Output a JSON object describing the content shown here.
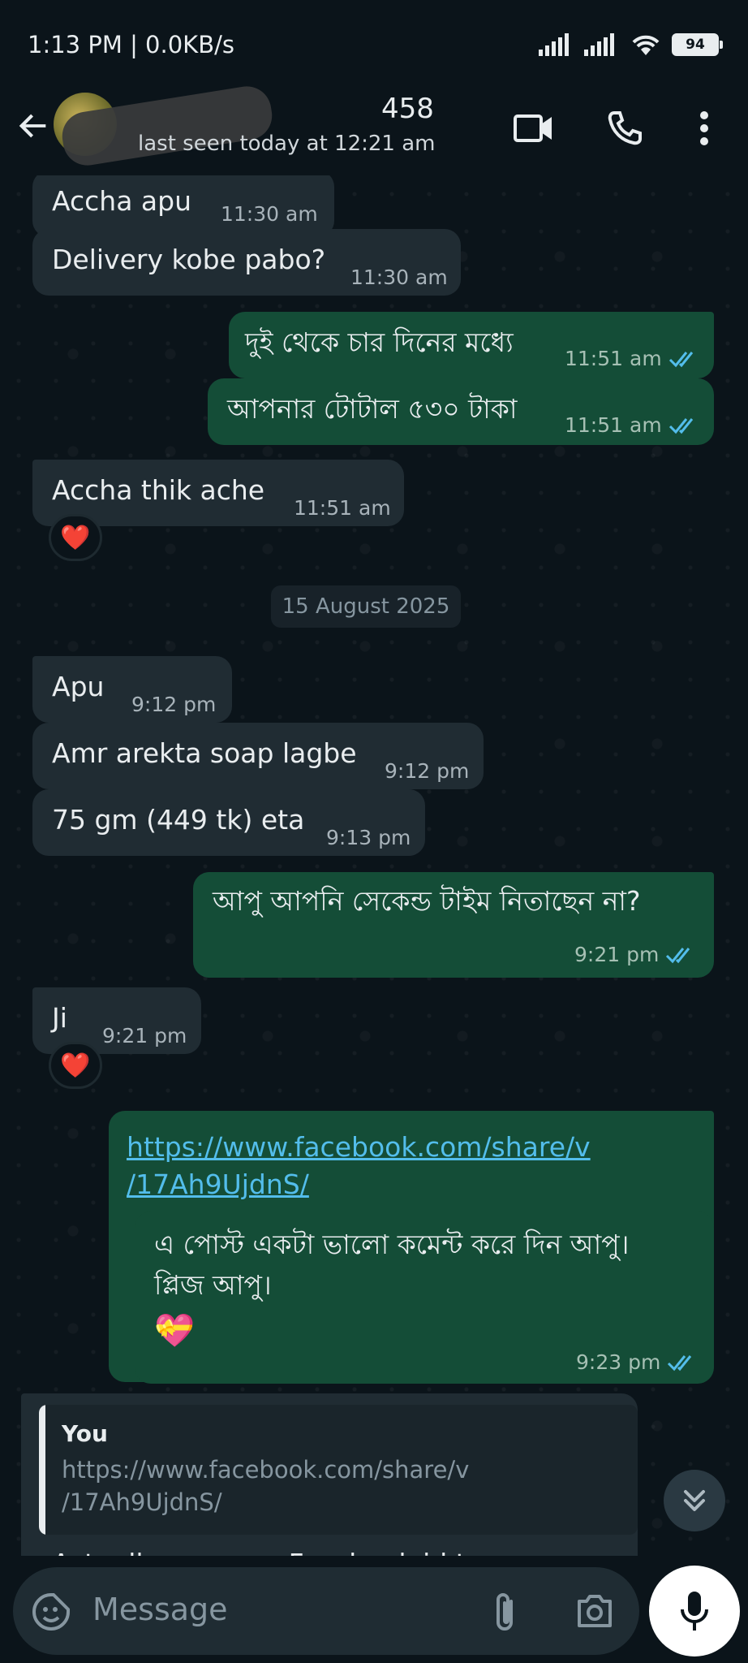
{
  "status_bar": {
    "time": "1:13 PM | 0.0KB/s",
    "battery": "94"
  },
  "header": {
    "contact_name_visible": "458",
    "last_seen": "last seen today at 12:21 am"
  },
  "messages": [
    {
      "dir": "in",
      "text": "Accha apu",
      "time": "11:30 am"
    },
    {
      "dir": "in",
      "text": "Delivery kobe pabo?",
      "time": "11:30 am"
    },
    {
      "dir": "out",
      "text": "দুই থেকে চার দিনের মধ্যে",
      "time": "11:51 am"
    },
    {
      "dir": "out",
      "text": "আপনার টোটাল ৫৩০ টাকা",
      "time": "11:51 am"
    },
    {
      "dir": "in",
      "text": "Accha thik ache",
      "time": "11:51 am",
      "reaction": "❤️"
    },
    {
      "dir": "in",
      "text": "Apu",
      "time": "9:12 pm"
    },
    {
      "dir": "in",
      "text": "Amr arekta soap lagbe",
      "time": "9:12 pm"
    },
    {
      "dir": "in",
      "text": "75 gm (449 tk) eta",
      "time": "9:13 pm"
    },
    {
      "dir": "out",
      "text": "আপু আপনি সেকেন্ড টাইম নিতাছেন না?",
      "time": "9:21 pm"
    },
    {
      "dir": "in",
      "text": "Ji",
      "time": "9:21 pm",
      "reaction": "❤️"
    },
    {
      "dir": "out",
      "link_line1": "https://www.facebook.com/share/v",
      "link_line2": "/17Ah9UjdnS/",
      "time": "9:23 pm"
    },
    {
      "dir": "out",
      "line1": "এ পোস্ট একটা ভালো কমেন্ট করে দিন আপু।",
      "line2": "প্লিজ আপু।",
      "emoji": "💝",
      "time": "9:23 pm"
    }
  ],
  "date_chip": "15 August 2025",
  "quoted_reply": {
    "author": "You",
    "quote_line1": "https://www.facebook.com/share/v",
    "quote_line2": "/17Ah9UjdnS/",
    "reply_partial": "Actually apu amr Facebook id ta"
  },
  "input": {
    "placeholder": "Message"
  },
  "colors": {
    "bg": "#0b141a",
    "incoming": "#202c33",
    "outgoing": "#144d37",
    "link": "#53bdeb",
    "tick": "#53bdeb"
  },
  "icons": [
    "back-arrow-icon",
    "video-call-icon",
    "phone-icon",
    "more-vert-icon",
    "sticker-icon",
    "attach-icon",
    "camera-icon",
    "mic-icon",
    "chevron-double-down-icon",
    "double-tick-icon",
    "heart-icon"
  ]
}
